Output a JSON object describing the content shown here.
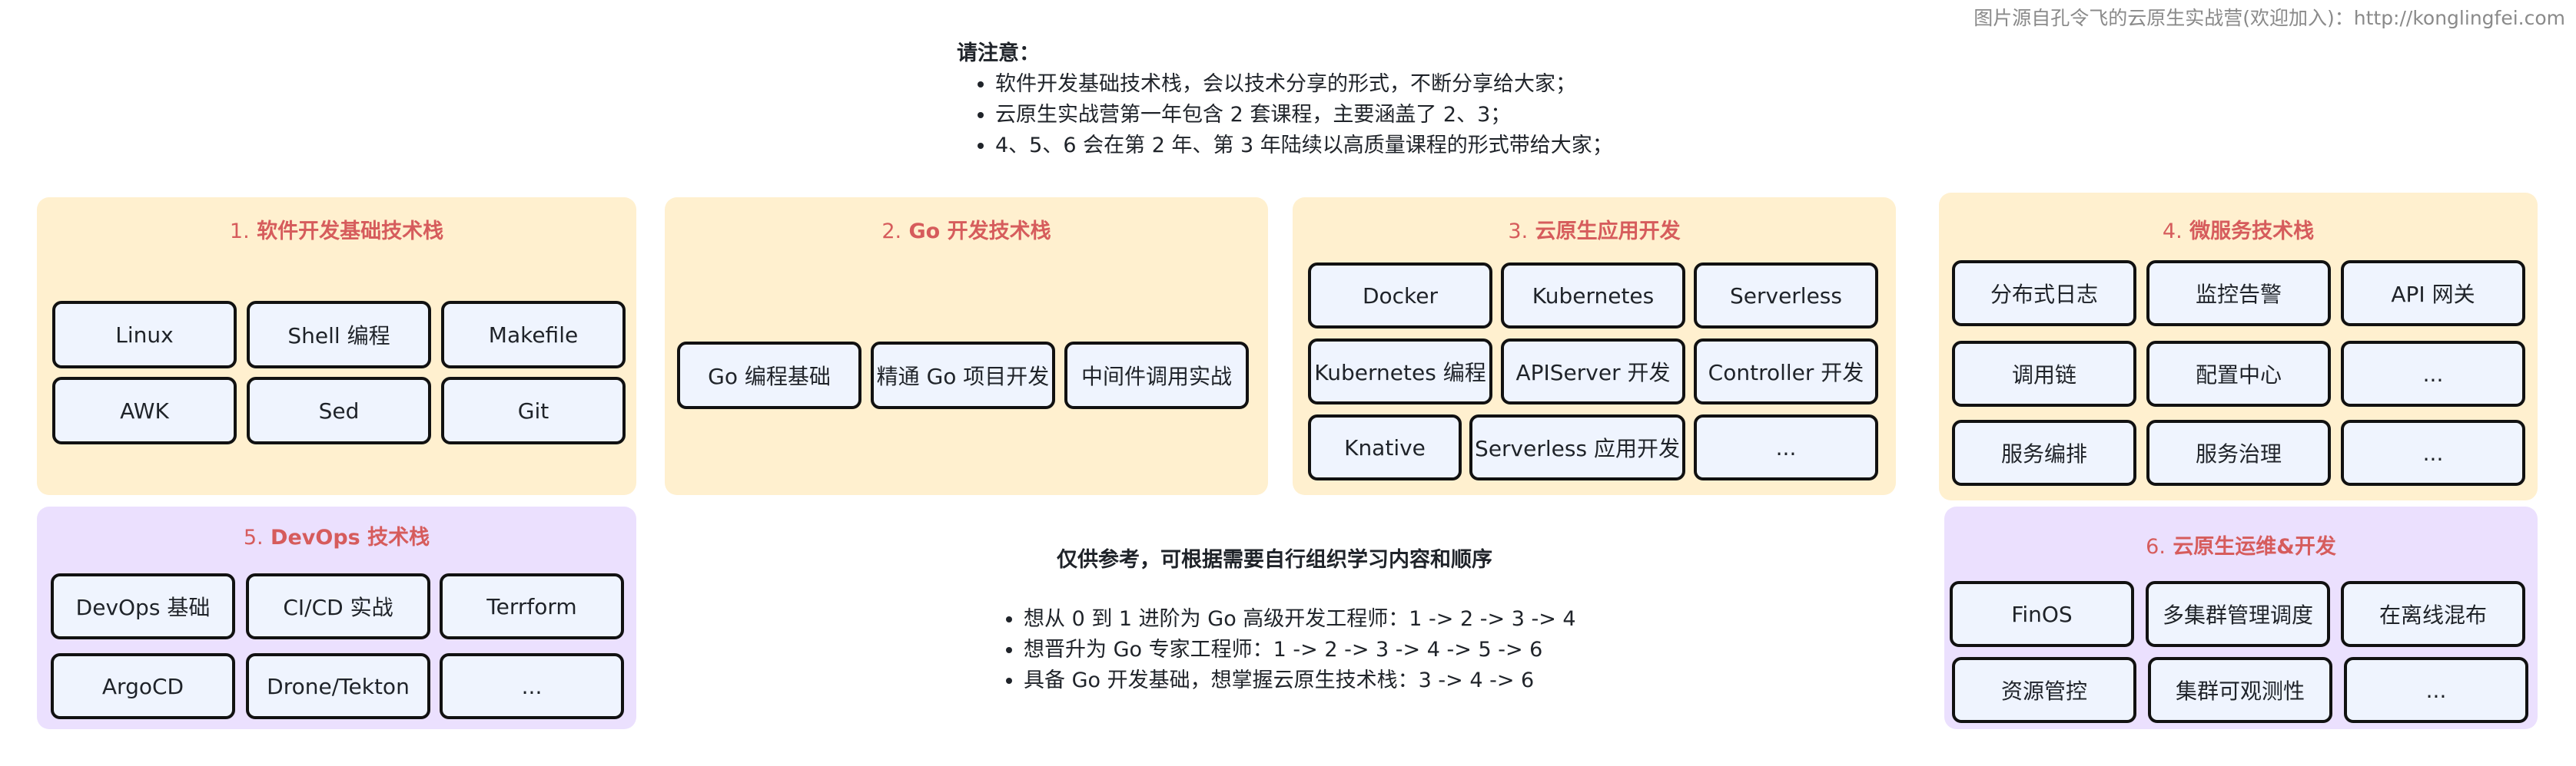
{
  "watermark": "图片源自孔令飞的云原生实战营(欢迎加入)：http://konglingfei.com",
  "notes": {
    "title": "请注意：",
    "items": [
      "软件开发基础技术栈，会以技术分享的形式，不断分享给大家；",
      "云原生实战营第一年包含 2 套课程，主要涵盖了 2、3；",
      "4、5、6 会在第 2 年、第 3 年陆续以高质量课程的形式带给大家；"
    ]
  },
  "panels": [
    {
      "num": "1.",
      "title": "软件开发基础技术栈",
      "items": [
        "Linux",
        "Shell 编程",
        "Makefile",
        "AWK",
        "Sed",
        "Git"
      ]
    },
    {
      "num": "2.",
      "title": "Go 开发技术栈",
      "items": [
        "Go 编程基础",
        "精通 Go 项目开发",
        "中间件调用实战"
      ]
    },
    {
      "num": "3.",
      "title": "云原生应用开发",
      "items": [
        "Docker",
        "Kubernetes",
        "Serverless",
        "Kubernetes 编程",
        "APIServer 开发",
        "Controller  开发",
        "Knative",
        "Serverless 应用开发",
        "..."
      ]
    },
    {
      "num": "4.",
      "title": "微服务技术栈",
      "items": [
        "分布式日志",
        "监控告警",
        "API 网关",
        "调用链",
        "配置中心",
        "...",
        "服务编排",
        "服务治理",
        "..."
      ]
    },
    {
      "num": "5.",
      "title": "DevOps 技术栈",
      "items": [
        "DevOps 基础",
        "CI/CD 实战",
        "Terrform",
        "ArgoCD",
        "Drone/Tekton",
        "..."
      ]
    },
    {
      "num": "6.",
      "title": "云原生运维&开发",
      "items": [
        "FinOS",
        "多集群管理调度",
        "在离线混布",
        "资源管控",
        "集群可观测性",
        "..."
      ]
    }
  ],
  "center": {
    "title": "仅供参考，可根据需要自行组织学习内容和顺序",
    "paths": [
      "想从 0 到 1 进阶为 Go 高级开发工程师：1 -> 2 -> 3 -> 4",
      "想晋升为 Go 专家工程师：1 -> 2 -> 3 -> 4 -> 5 -> 6",
      "具备 Go 开发基础，想掌握云原生技术栈：3 -> 4 -> 6"
    ]
  },
  "colors": {
    "panel_yellow": "#fff0cf",
    "panel_purple": "#ebe0fe",
    "chip_fill": "#eff4fe",
    "title_red": "#d65c5c"
  }
}
